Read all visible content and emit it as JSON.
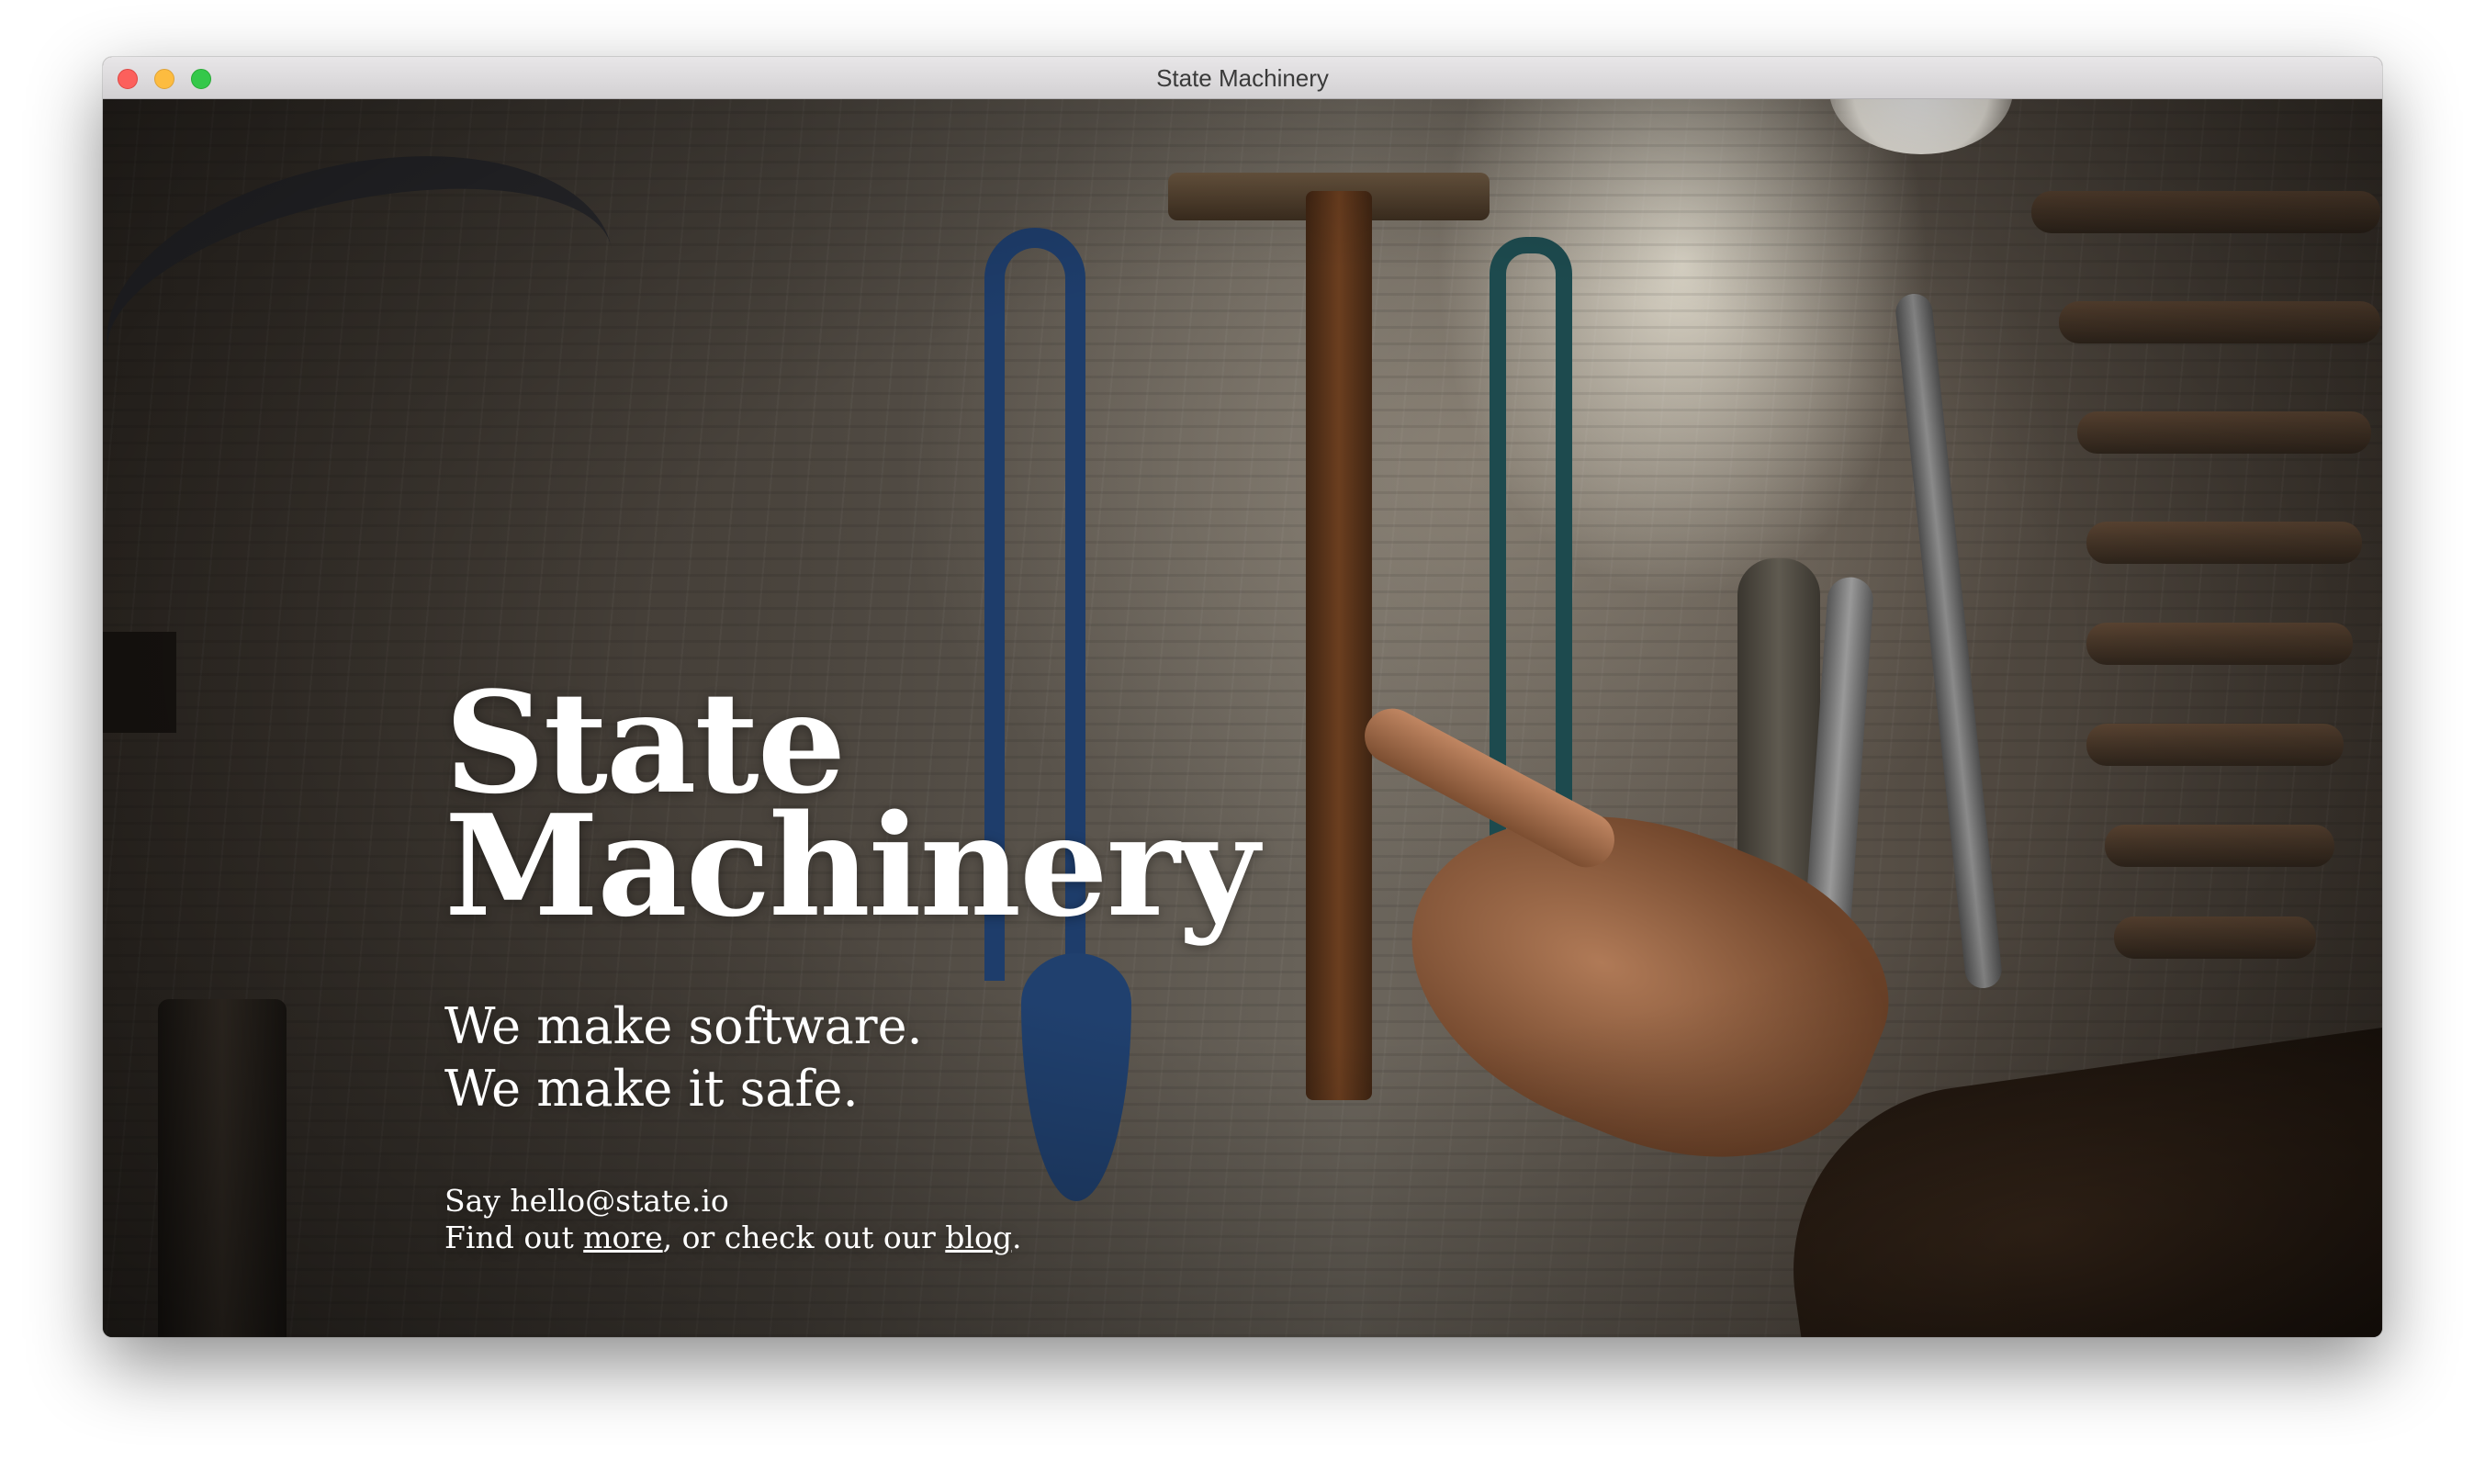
{
  "window": {
    "title": "State Machinery"
  },
  "hero": {
    "title_line1": "State",
    "title_line2": "Machinery",
    "tagline_line1": "We make software.",
    "tagline_line2": "We make it safe.",
    "contact_say": "Say hello@state.io",
    "contact_find_prefix": "Find out ",
    "more_link": "more",
    "contact_middle": ", or check out our ",
    "blog_link": "blog",
    "contact_suffix": "."
  },
  "colors": {
    "text": "#ffffff",
    "close": "#fc605c",
    "minimize": "#fdbc40",
    "zoom": "#34c84a"
  }
}
